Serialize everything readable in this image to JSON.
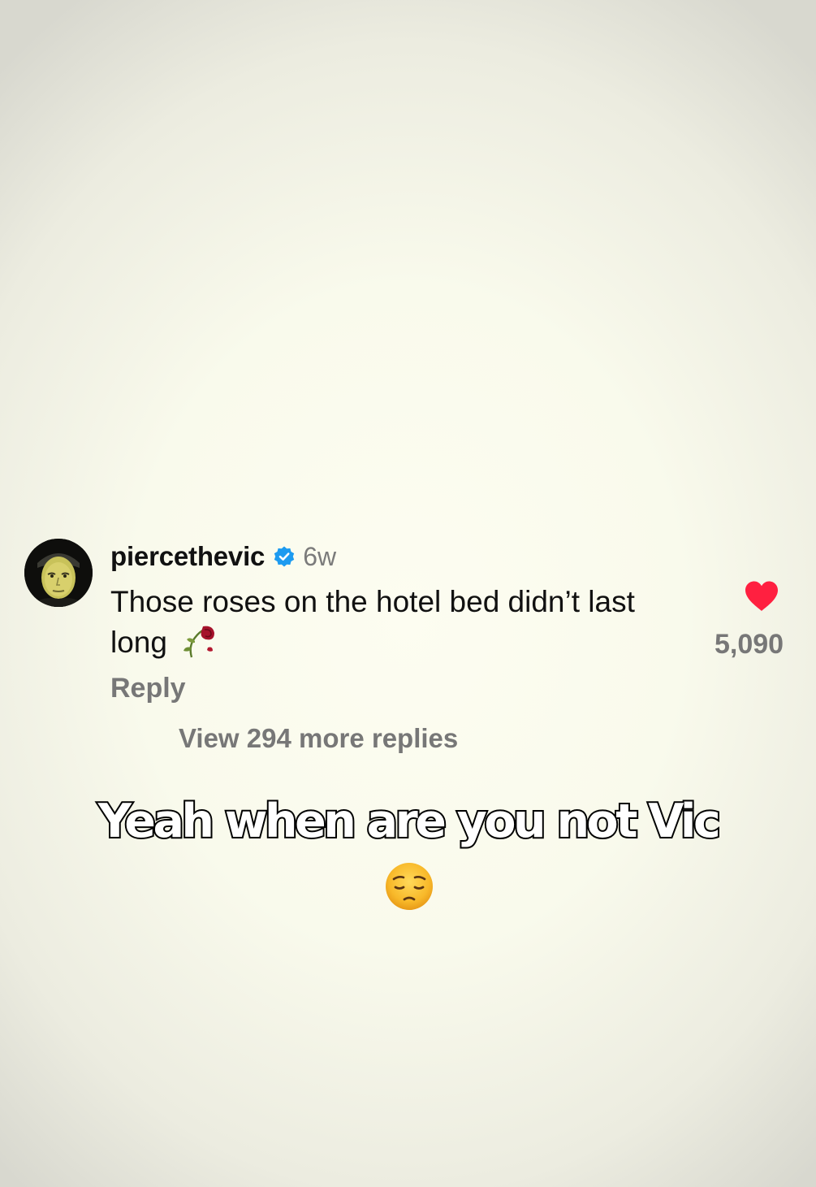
{
  "comment": {
    "username": "piercethevic",
    "verified_icon": "verified-badge-icon",
    "verified_color": "#1d9bf0",
    "timestamp": "6w",
    "text": "Those roses on the hotel bed didn’t last long",
    "text_emoji": "wilted-rose-icon",
    "reply_label": "Reply",
    "view_replies_label": "View 294 more replies",
    "like_icon": "heart-icon",
    "like_color": "#ff2040",
    "like_count": "5,090"
  },
  "caption": {
    "line1": "Yeah when are you not Vic",
    "emoji": "pensive-face-emoji"
  }
}
